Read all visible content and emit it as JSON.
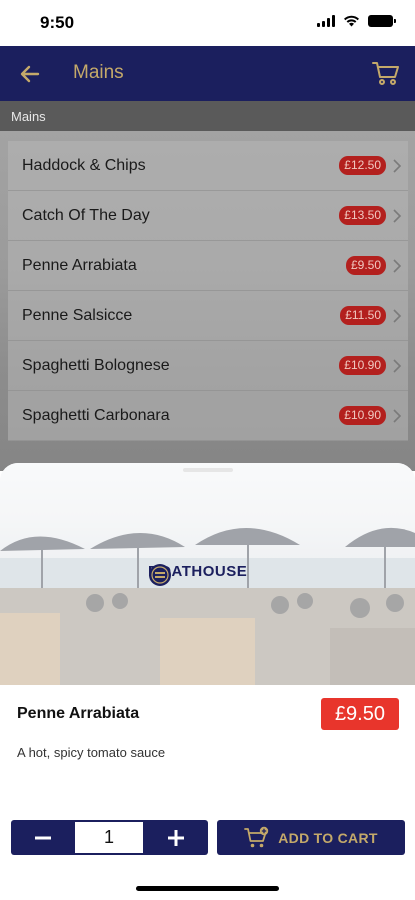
{
  "status_bar": {
    "time": "9:50"
  },
  "header": {
    "title": "Mains"
  },
  "section": {
    "label": "Mains"
  },
  "menu": {
    "items": [
      {
        "name": "Haddock & Chips",
        "price": "£12.50"
      },
      {
        "name": "Catch Of The Day",
        "price": "£13.50"
      },
      {
        "name": "Penne Arrabiata",
        "price": "£9.50"
      },
      {
        "name": "Penne Salsicce",
        "price": "£11.50"
      },
      {
        "name": "Spaghetti Bolognese",
        "price": "£10.90"
      },
      {
        "name": "Spaghetti Carbonara",
        "price": "£10.90"
      }
    ]
  },
  "product": {
    "logo_text": "BOATHOUSE",
    "name": "Penne Arrabiata",
    "price": "£9.50",
    "description": "A hot, spicy tomato sauce"
  },
  "controls": {
    "quantity": "1",
    "add_to_cart_label": "ADD TO CART"
  },
  "colors": {
    "header_bg": "#1b1f5e",
    "accent_gold": "#c4a96a",
    "price_red": "#e8352c"
  }
}
